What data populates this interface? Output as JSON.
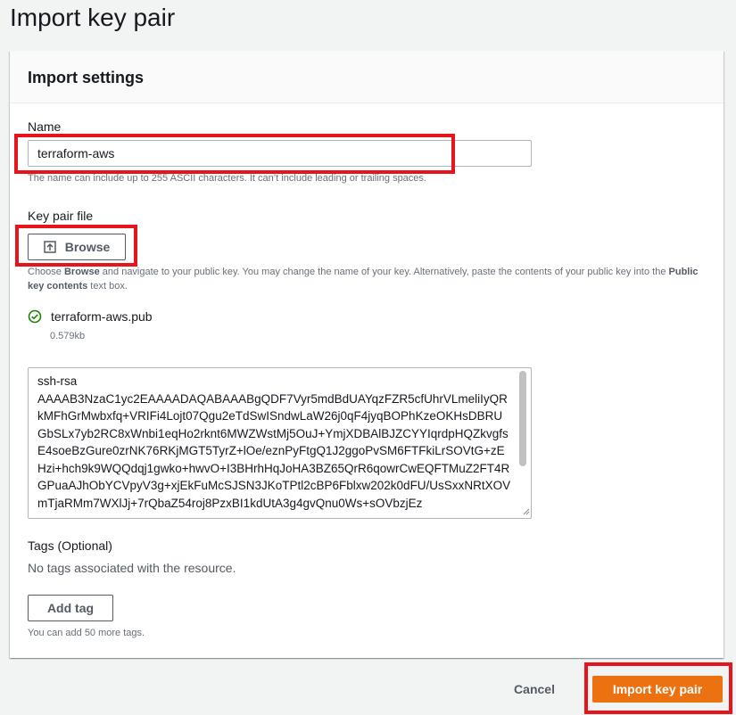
{
  "page": {
    "title": "Import key pair"
  },
  "panel": {
    "title": "Import settings"
  },
  "name_field": {
    "label": "Name",
    "value": "terraform-aws",
    "hint": "The name can include up to 255 ASCII characters. It can’t include leading or trailing spaces."
  },
  "key_pair_file": {
    "label": "Key pair file",
    "browse_label": "Browse",
    "hint_part1": "Choose ",
    "hint_bold1": "Browse",
    "hint_part2": " and navigate to your public key. You may change the name of your key. Alternatively, paste the contents of your public key into the ",
    "hint_bold2": "Public key contents",
    "hint_part3": " text box.",
    "file_name": "terraform-aws.pub",
    "file_size": "0.579kb",
    "status_color": "#1d8102"
  },
  "public_key": {
    "contents": "ssh-rsa\nAAAAB3NzaC1yc2EAAAADAQABAAABgQDF7Vyr5mdBdUAYqzFZR5cfUhrVLmeliIyQRkMFhGrMwbxfq+VRIFi4Lojt07Qgu2eTdSwISndwLaW26j0qF4jyqBOPhKzeOKHsDBRUGbSLx7yb2RC8xWnbi1eqHo2rknt6MWZWstMj5OuJ+YmjXDBAlBJZCYYIqrdpHQZkvgfsE4soeBzGure0zrNK76RKjMGT5TyrZ+lOe/eznPyFtgQ1J2ggoPvSM6FTFkiLrSOVtG+zEHzi+hch9k9WQQdqj1gwko+hwvO+I3BHrhHqJoHA3BZ65QrR6qowrCwEQFTMuZ2FT4RGPuaAJhObYCVpyV3g+xjEkFuMcSJSN3JKoTPtl2cBP6Fblxw202k0dFU/UsSxxNRtXOVmTjaRMm7WXlJj+7rQbaZ54roj8PzxBI1kdUtA3g4gvQnu0Ws+sOVbzjEz"
  },
  "tags": {
    "label": "Tags (Optional)",
    "empty_text": "No tags associated with the resource.",
    "add_label": "Add tag",
    "hint": "You can add 50 more tags."
  },
  "footer": {
    "cancel_label": "Cancel",
    "import_label": "Import key pair"
  },
  "colors": {
    "accent": "#ec7211",
    "highlight": "#e8141c"
  }
}
